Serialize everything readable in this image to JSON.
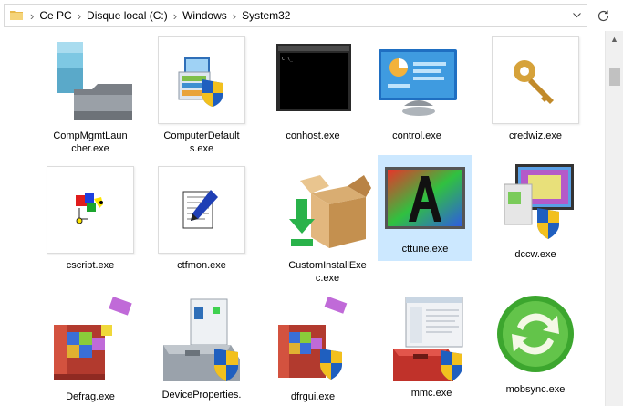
{
  "address": {
    "crumbs": [
      "Ce PC",
      "Disque local (C:)",
      "Windows",
      "System32"
    ]
  },
  "items": [
    {
      "label": "CompMgmtLauncher.exe",
      "line1": "CompMgmtLaun",
      "line2": "cher.exe"
    },
    {
      "label": "ComputerDefaults.exe",
      "line1": "ComputerDefault",
      "line2": "s.exe"
    },
    {
      "label": "conhost.exe",
      "line1": "conhost.exe",
      "line2": ""
    },
    {
      "label": "control.exe",
      "line1": "control.exe",
      "line2": ""
    },
    {
      "label": "credwiz.exe",
      "line1": "credwiz.exe",
      "line2": ""
    },
    {
      "label": "cscript.exe",
      "line1": "cscript.exe",
      "line2": ""
    },
    {
      "label": "ctfmon.exe",
      "line1": "ctfmon.exe",
      "line2": ""
    },
    {
      "label": "CustomInstallExec.exe",
      "line1": "CustomInstallExe",
      "line2": "c.exe"
    },
    {
      "label": "cttune.exe",
      "line1": "cttune.exe",
      "line2": ""
    },
    {
      "label": "dccw.exe",
      "line1": "dccw.exe",
      "line2": ""
    },
    {
      "label": "Defrag.exe",
      "line1": "Defrag.exe",
      "line2": ""
    },
    {
      "label": "DeviceProperties.exe",
      "line1": "DeviceProperties.",
      "line2": ""
    },
    {
      "label": "dfrgui.exe",
      "line1": "dfrgui.exe",
      "line2": ""
    },
    {
      "label": "mmc.exe",
      "line1": "mmc.exe",
      "line2": ""
    },
    {
      "label": "mobsync.exe",
      "line1": "mobsync.exe",
      "line2": ""
    }
  ],
  "selected_item": "cttune.exe",
  "colors": {
    "selection": "#cce8ff",
    "uac_blue": "#1f5fbf",
    "uac_yellow": "#f2c01e"
  }
}
